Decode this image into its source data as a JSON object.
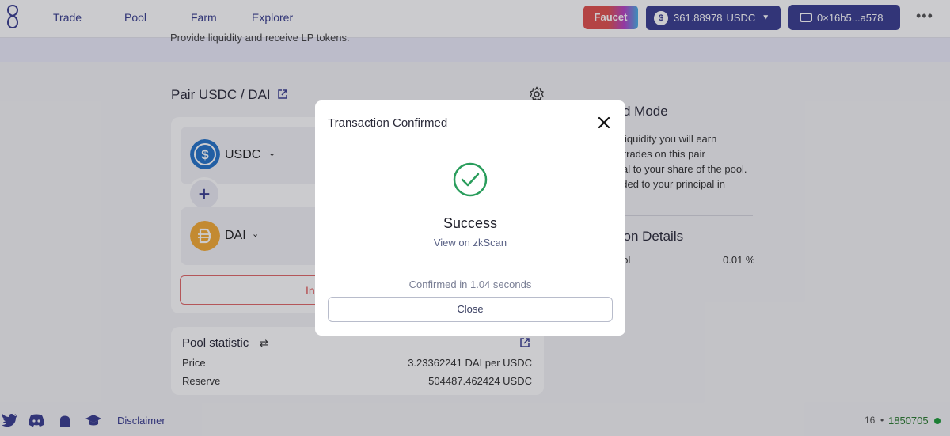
{
  "nav": {
    "items": [
      "Trade",
      "Pool",
      "Farm",
      "Explorer"
    ],
    "faucet_label": "Faucet",
    "balance_amount": "361.88978",
    "balance_currency": "USDC",
    "wallet_address": "0×16b5...a578",
    "more_label": "•••"
  },
  "banner": {
    "subtitle": "Provide liquidity and receive LP tokens."
  },
  "pair": {
    "title": "Pair USDC / DAI",
    "token_a": "USDC",
    "token_b": "DAI",
    "plus_label": "+",
    "action_label": "In"
  },
  "stats": {
    "title": "Pool statistic",
    "refresh_icon": "⇄",
    "rows": [
      {
        "label": "Price",
        "value": "3.23362241 DAI per USDC"
      },
      {
        "label": "Reserve",
        "value": "504487.462424 USDC"
      }
    ]
  },
  "info": {
    "mode_title": "d Mode",
    "mode_lines": [
      "iquidity you will earn",
      "l trades on this pair",
      "al to your share of the pool.",
      "dded to your principal in"
    ],
    "details_title": "tion Details",
    "details_label": "ool",
    "details_value": "0.01 %"
  },
  "footer": {
    "disclaimer": "Disclaimer",
    "block_prefix": "16",
    "block_sep": "•",
    "block_height": "1850705"
  },
  "modal": {
    "title": "Transaction Confirmed",
    "status": "Success",
    "link_text": "View on zkScan",
    "confirmed_text": "Confirmed in 1.04 seconds",
    "close_label": "Close"
  },
  "colors": {
    "accent": "#3c3f91",
    "success": "#2a9d5c",
    "error": "#e25353",
    "usdc": "#2775ca",
    "dai": "#f5ac37"
  }
}
